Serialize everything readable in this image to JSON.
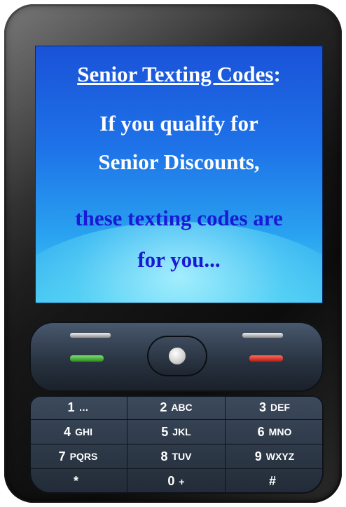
{
  "screen": {
    "title": "Senior Texting Codes",
    "title_colon": ":",
    "line1": "If you qualify for",
    "line2": "Senior Discounts,",
    "line3": "these texting codes  are",
    "line4": "for you..."
  },
  "keypad": {
    "keys": [
      {
        "num": "1",
        "letters": "…"
      },
      {
        "num": "2",
        "letters": "ABC"
      },
      {
        "num": "3",
        "letters": "DEF"
      },
      {
        "num": "4",
        "letters": "GHI"
      },
      {
        "num": "5",
        "letters": "JKL"
      },
      {
        "num": "6",
        "letters": "MNO"
      },
      {
        "num": "7",
        "letters": "PQRS"
      },
      {
        "num": "8",
        "letters": "TUV"
      },
      {
        "num": "9",
        "letters": "WXYZ"
      },
      {
        "num": "*",
        "letters": ""
      },
      {
        "num": "0",
        "letters": "+"
      },
      {
        "num": "#",
        "letters": ""
      }
    ]
  },
  "colors": {
    "screen_top": "#1a52d8",
    "screen_bottom": "#4fd0f4",
    "white_text": "#ffffff",
    "blue_text": "#1a1ad6",
    "call_green": "#2b8a22",
    "call_red": "#b31c12"
  }
}
